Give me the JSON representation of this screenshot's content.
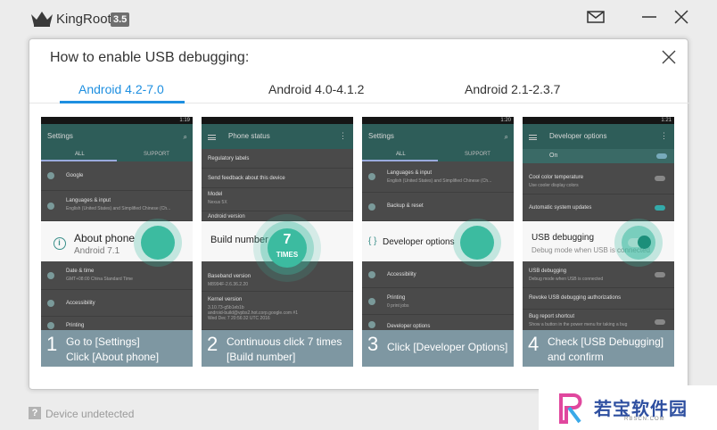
{
  "window": {
    "app_name": "KingRoot",
    "version": "3.5",
    "icons": [
      "crown-icon",
      "mail-icon",
      "minimize-icon",
      "close-icon"
    ]
  },
  "dialog": {
    "title": "How to enable USB debugging:",
    "tabs": [
      {
        "label": "Android 4.2-7.0",
        "active": true
      },
      {
        "label": "Android 4.0-4.1.2",
        "active": false
      },
      {
        "label": "Android 2.1-2.3.7",
        "active": false
      }
    ]
  },
  "steps": [
    {
      "number": "1",
      "caption": "Go to [Settings]\nClick [About phone]",
      "screen": {
        "time": "1:19",
        "title": "Settings",
        "tab_all": "ALL",
        "tab_support": "SUPPORT",
        "rows_top": [
          {
            "title": "Google"
          },
          {
            "title": "Languages & input",
            "sub": "English (United States) and Simplified Chinese (Ch..."
          }
        ],
        "highlight_title": "About phone",
        "highlight_sub": "Android 7.1",
        "rows_bottom": [
          {
            "title": "Date & time",
            "sub": "GMT+08:00 China Standard Time"
          },
          {
            "title": "Accessibility"
          },
          {
            "title": "Printing"
          }
        ]
      }
    },
    {
      "number": "2",
      "caption": "Continuous click 7 times\n[Build number]",
      "tap_count": "7",
      "tap_label": "TIMES",
      "screen": {
        "title": "Phone status",
        "rows_top": [
          {
            "title": "Regulatory labels"
          },
          {
            "title": "Send feedback about this device"
          },
          {
            "title": "Model",
            "sub": "Nexus 5X"
          },
          {
            "title": "Android version"
          }
        ],
        "highlight_title": "Build number",
        "rows_bottom": [
          {
            "title": "Baseband version",
            "sub": "M8994F-2.6.36.2.20"
          },
          {
            "title": "Kernel version",
            "sub": "3.10.73-g5b1eb1b\nandroid-build@vpbs2.hot.corp.google.com #1\nWed Dec 7 20:56:32 UTC 2016"
          }
        ]
      }
    },
    {
      "number": "3",
      "caption": "Click [Developer Options]",
      "screen": {
        "time": "1:20",
        "title": "Settings",
        "tab_all": "ALL",
        "tab_support": "SUPPORT",
        "rows_top": [
          {
            "title": "Languages & input",
            "sub": "English (United States) and Simplified Chinese (Ch..."
          },
          {
            "title": "Backup & reset"
          }
        ],
        "highlight_title": "Developer options",
        "rows_bottom": [
          {
            "title": "Accessibility"
          },
          {
            "title": "Printing",
            "sub": "0 print jobs"
          },
          {
            "title": "Developer options"
          }
        ]
      }
    },
    {
      "number": "4",
      "caption": "Check [USB Debugging]\nand confirm",
      "screen": {
        "time": "1:21",
        "title": "Developer options",
        "on_label": "On",
        "rows_top": [
          {
            "title": "Cool color temperature",
            "sub": "Use cooler display colors"
          },
          {
            "title": "Automatic system updates"
          }
        ],
        "highlight_title": "USB debugging",
        "highlight_sub": "Debug mode when USB is connected",
        "rows_bottom": [
          {
            "title": "USB debugging",
            "sub": "Debug mode when USB is connected"
          },
          {
            "title": "Revoke USB debugging authorizations"
          },
          {
            "title": "Bug report shortcut",
            "sub": "Show a button in the power menu for taking a bug"
          }
        ]
      }
    }
  ],
  "status": {
    "icon": "?",
    "text": "Device undetected"
  },
  "watermark": {
    "text": "若宝软件园",
    "url": "RBSCN.COM"
  },
  "colors": {
    "accent": "#1e8fe0",
    "tap": "#3cbba0",
    "caption_bg": "#7e97a2"
  }
}
